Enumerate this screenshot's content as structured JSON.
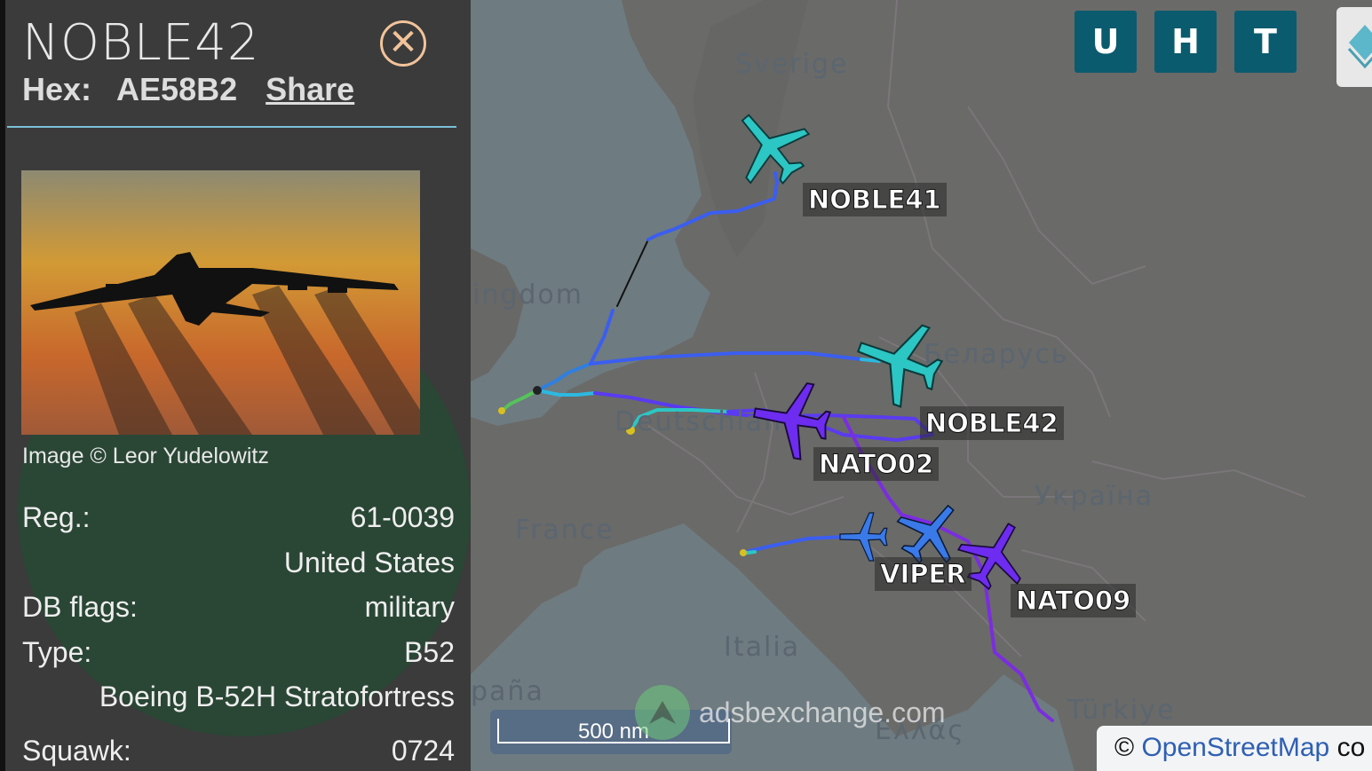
{
  "panel": {
    "callsign": "NOBLE42",
    "hex_label": "Hex:",
    "hex_value": "AE58B2",
    "share_label": "Share",
    "image_credit": "Image © Leor Yudelowitz",
    "rows": {
      "reg_label": "Reg.:",
      "reg_value": "61-0039",
      "country_value": "United States",
      "dbflags_label": "DB flags:",
      "dbflags_value": "military",
      "type_label": "Type:",
      "type_value": "B52",
      "type_desc": "Boeing B-52H Stratofortress",
      "squawk_label": "Squawk:",
      "squawk_value": "0724"
    }
  },
  "map": {
    "buttons": [
      "U",
      "H",
      "T"
    ],
    "countries": [
      "Sverige",
      "ingdom",
      "Беларусь",
      "Deutschland",
      "France",
      "Україна",
      "Italia",
      "paña",
      "Türkiye",
      "Ελλάς"
    ],
    "aircraft_labels": [
      "NOBLE41",
      "NOBLE42",
      "NATO02",
      "VIPER",
      "NATO09"
    ],
    "scale_label": "500 nm",
    "watermark": "adsbexchange.com",
    "attribution_prefix": "©",
    "attribution_link": "OpenStreetMap",
    "attribution_suffix": "co"
  },
  "colors": {
    "button_bg": "#0b5b6e",
    "accent_divider": "#7bc0d8",
    "close_icon": "#f2c39a",
    "aircraft_cyan": "#2cc6c4",
    "aircraft_purple": "#6d2cf0",
    "aircraft_blue": "#3a7ae8"
  }
}
